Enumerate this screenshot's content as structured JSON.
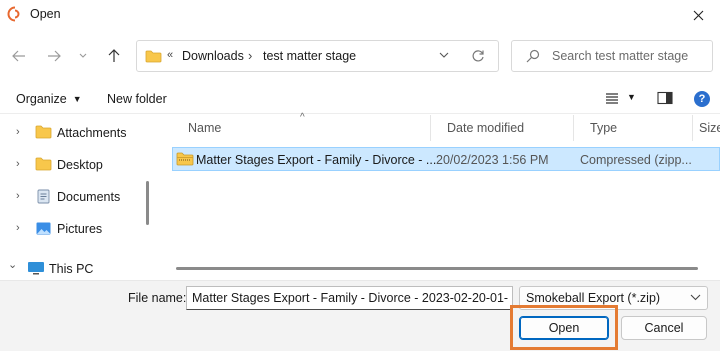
{
  "window": {
    "title": "Open"
  },
  "address": {
    "overflow": "«",
    "crumbs": [
      "Downloads",
      "test matter stage"
    ],
    "separator": "›"
  },
  "search": {
    "placeholder": "Search test matter stage"
  },
  "toolbar": {
    "organize_label": "Organize",
    "new_folder_label": "New folder",
    "help_label": "?"
  },
  "sidebar": {
    "items": [
      {
        "label": "Attachments",
        "icon": "folder-icon",
        "expander": "›"
      },
      {
        "label": "Desktop",
        "icon": "folder-icon",
        "expander": "›"
      },
      {
        "label": "Documents",
        "icon": "documents-icon",
        "expander": "›"
      },
      {
        "label": "Pictures",
        "icon": "pictures-icon",
        "expander": "›"
      },
      {
        "label": "This PC",
        "icon": "computer-icon",
        "expander": "⌄"
      }
    ]
  },
  "files": {
    "columns": {
      "name": "Name",
      "date": "Date modified",
      "type": "Type",
      "size": "Size"
    },
    "sort_indicator": "^",
    "rows": [
      {
        "name": "Matter Stages Export - Family - Divorce - ...",
        "date": "20/02/2023 1:56 PM",
        "type": "Compressed (zipp...",
        "selected": true
      }
    ]
  },
  "footer": {
    "file_name_label": "File name:",
    "file_name_value": "Matter Stages Export - Family - Divorce - 2023-02-20-01-",
    "file_type_value": "Smokeball Export (*.zip)",
    "open_label": "Open",
    "cancel_label": "Cancel"
  },
  "colors": {
    "accent": "#0067c0",
    "selection": "#cce8ff",
    "highlight": "#e47b33",
    "folder": "#f8c74b"
  }
}
